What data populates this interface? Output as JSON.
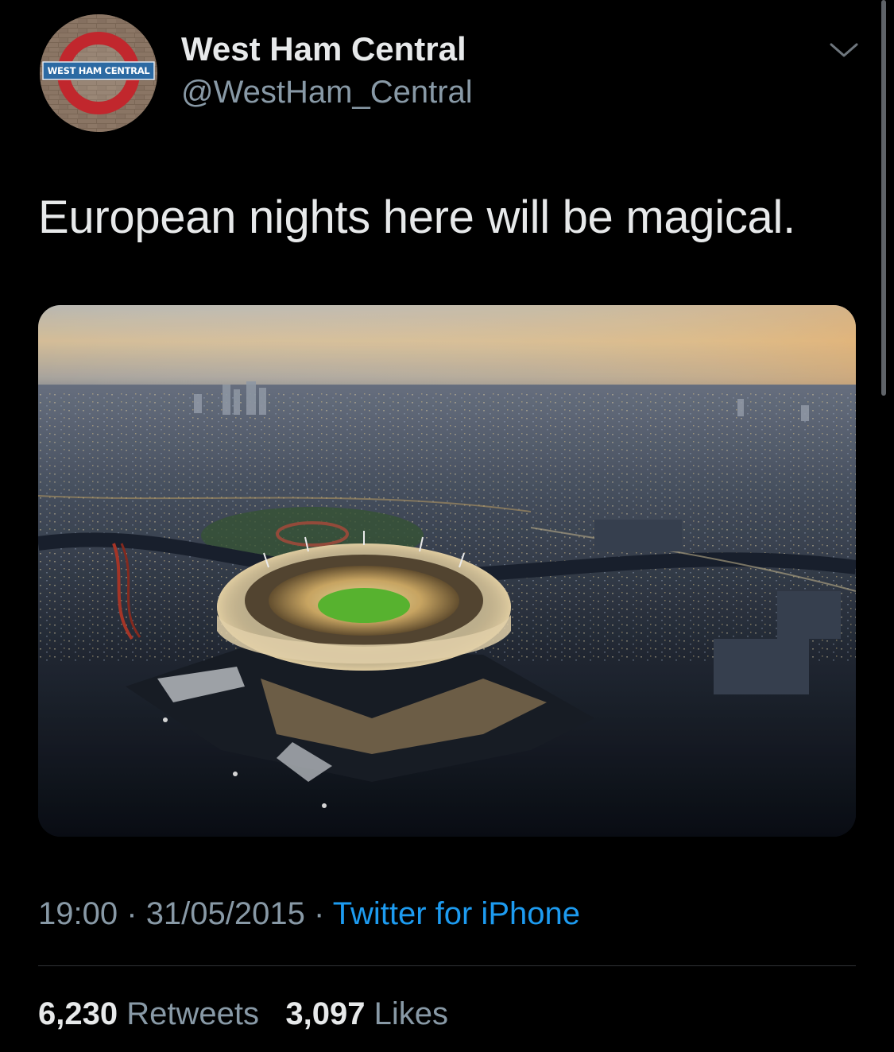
{
  "tweet": {
    "display_name": "West Ham Central",
    "handle": "@WestHam_Central",
    "text": "European nights here will be magical.",
    "avatar": {
      "icon": "west-ham-central-roundel-logo",
      "logo_text": "WEST HAM CENTRAL"
    },
    "media": {
      "description_icon": "stadium-aerial-photo"
    },
    "time": "19:00",
    "date": "31/05/2015",
    "separator": "·",
    "source": "Twitter for iPhone",
    "retweets_count": "6,230",
    "retweets_label": "Retweets",
    "likes_count": "3,097",
    "likes_label": "Likes",
    "menu_icon": "chevron-down-icon"
  },
  "colors": {
    "background": "#000000",
    "link": "#1d9bf0",
    "secondary_text": "#8899a6",
    "primary_text": "#e7e9ea"
  }
}
